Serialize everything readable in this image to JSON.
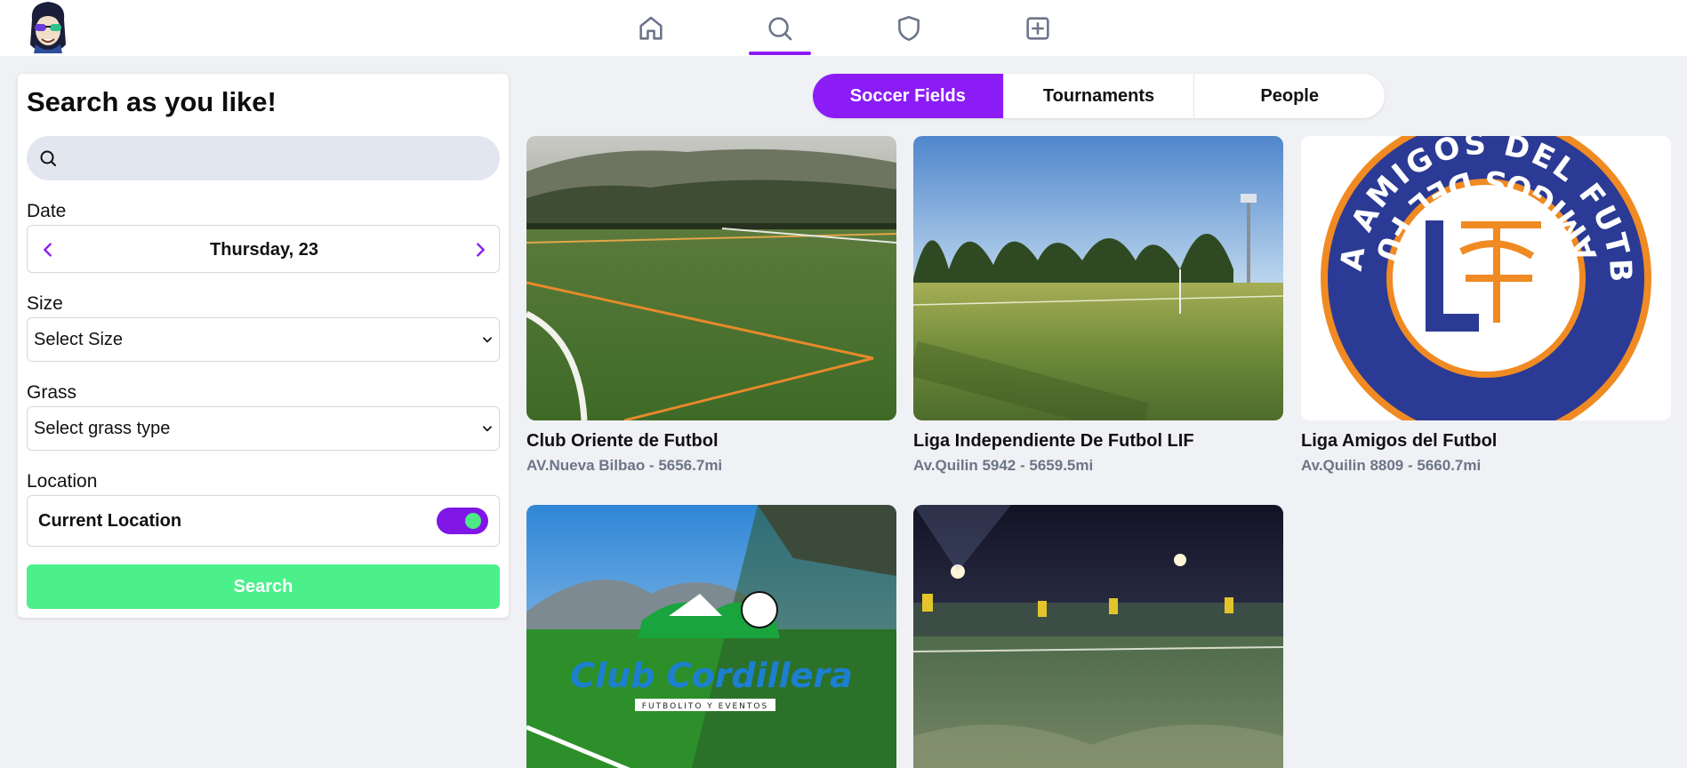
{
  "nav": {
    "items": [
      {
        "name": "home-icon"
      },
      {
        "name": "search-icon"
      },
      {
        "name": "shield-icon"
      },
      {
        "name": "add-icon"
      }
    ],
    "active": "search-icon"
  },
  "sidebar": {
    "title": "Search as you like!",
    "search": {
      "value": "",
      "placeholder": ""
    },
    "date": {
      "label": "Date",
      "value": "Thursday, 23"
    },
    "size": {
      "label": "Size",
      "value": "Select Size"
    },
    "grass": {
      "label": "Grass",
      "value": "Select grass type"
    },
    "location": {
      "label": "Location",
      "toggle_label": "Current Location",
      "enabled": true
    },
    "search_button": "Search"
  },
  "tabs": [
    {
      "label": "Soccer Fields",
      "active": true
    },
    {
      "label": "Tournaments",
      "active": false
    },
    {
      "label": "People",
      "active": false
    }
  ],
  "fields": [
    {
      "name": "Club Oriente de Futbol",
      "address": "AV.Nueva Bilbao - 5656.7mi"
    },
    {
      "name": "Liga Independiente De Futbol LIF",
      "address": "Av.Quilin 5942 - 5659.5mi"
    },
    {
      "name": "Liga Amigos del Futbol",
      "address": "Av.Quilin 8809 - 5660.7mi"
    },
    {
      "name": "",
      "address": ""
    },
    {
      "name": "",
      "address": ""
    }
  ],
  "logos": {
    "liga_amigos_top": "LIGA AMIGOS DEL FUTBOL",
    "liga_amigos_bottom": "LIGA AMIGOS DEL FUTBOL",
    "club_cordillera": "Club Cordillera",
    "club_cordillera_sub": "FUTBOLITO Y EVENTOS"
  },
  "colors": {
    "accent": "#8b1cf5",
    "search_button": "#4bf08a",
    "toggle_knob": "#4ce985",
    "background": "#f0f1f5"
  }
}
